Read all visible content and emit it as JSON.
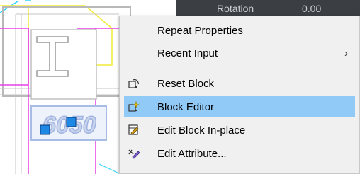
{
  "properties_panel": {
    "row_label": "Rotation",
    "row_value": "0.00"
  },
  "drawing": {
    "block_text": "6050"
  },
  "context_menu": {
    "items": [
      {
        "label": "Repeat Properties",
        "icon": null,
        "submenu": false,
        "highlighted": false
      },
      {
        "label": "Recent Input",
        "icon": null,
        "submenu": true,
        "highlighted": false
      },
      {
        "label": "Reset Block",
        "icon": "reset-block-icon",
        "submenu": false,
        "highlighted": false
      },
      {
        "label": "Block Editor",
        "icon": "block-editor-icon",
        "submenu": false,
        "highlighted": true
      },
      {
        "label": "Edit Block In-place",
        "icon": "edit-block-in-place-icon",
        "submenu": false,
        "highlighted": false
      },
      {
        "label": "Edit Attribute...",
        "icon": "edit-attribute-icon",
        "submenu": false,
        "highlighted": false
      }
    ],
    "submenu_arrow": "›",
    "highlight_color": "#91c9f7"
  }
}
